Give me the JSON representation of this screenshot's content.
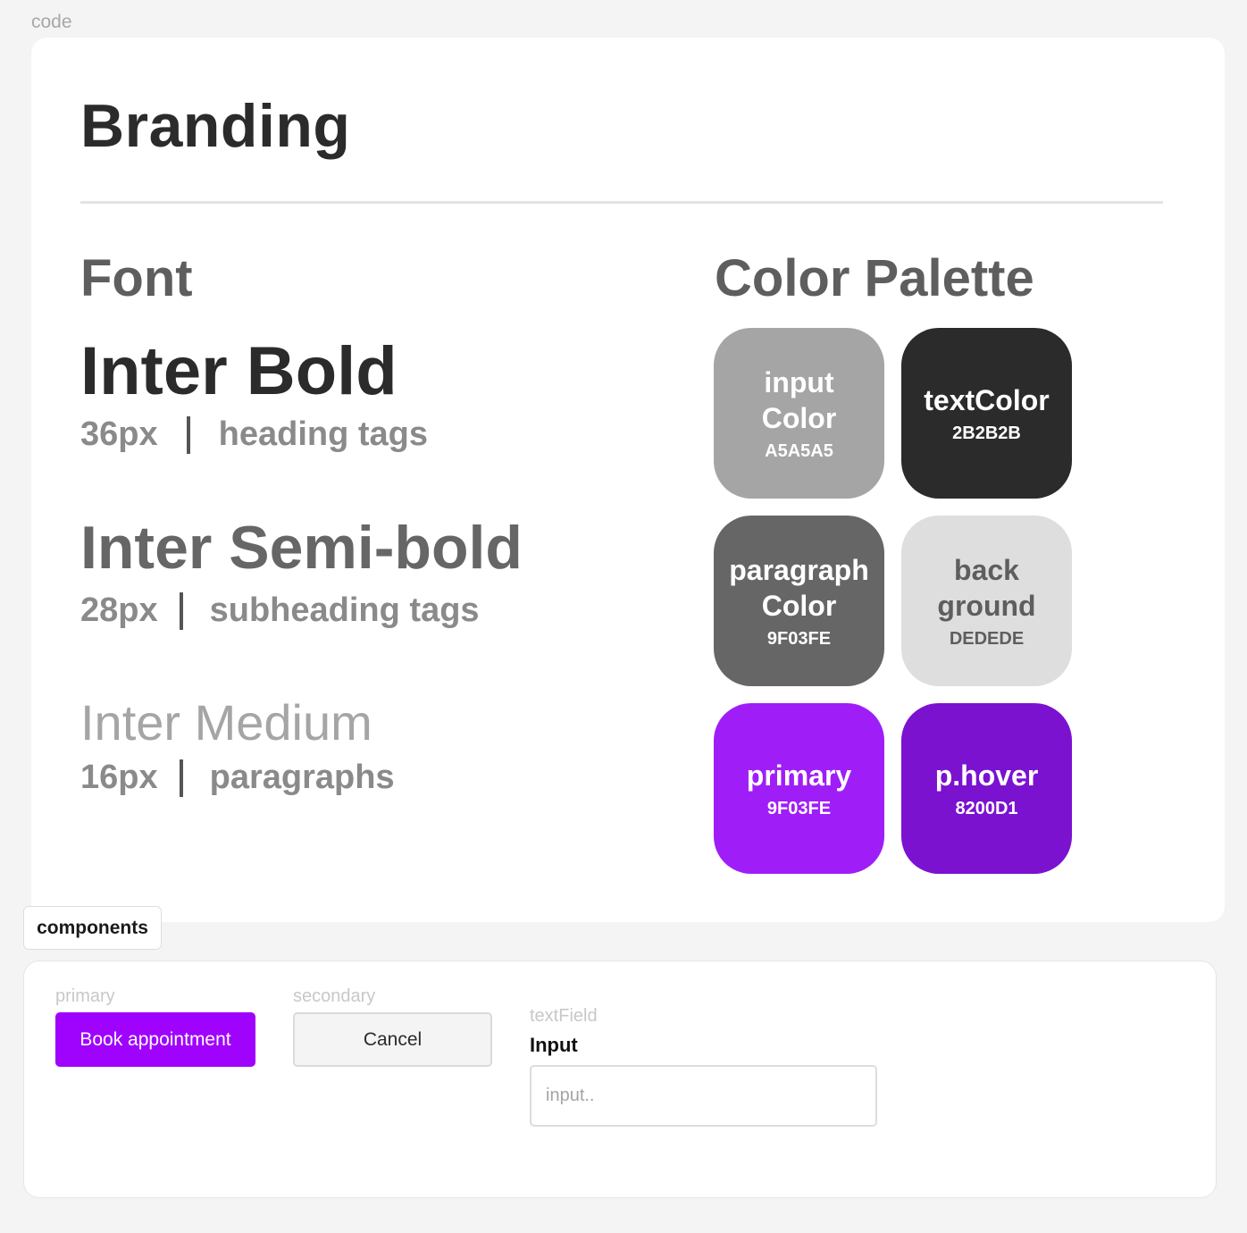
{
  "frame_label": "code",
  "branding": {
    "title": "Branding",
    "font": {
      "heading": "Font",
      "samples": [
        {
          "name": "Inter Bold",
          "size": "36px",
          "usage": "heading tags"
        },
        {
          "name": "Inter Semi-bold",
          "size": "28px",
          "usage": "subheading tags"
        },
        {
          "name": "Inter Medium",
          "size": "16px",
          "usage": "paragraphs"
        }
      ]
    },
    "palette": {
      "heading": "Color Palette",
      "swatches": [
        {
          "line1": "input",
          "line2": "Color",
          "hex": "A5A5A5",
          "bg": "#a5a5a5",
          "fg": "#ffffff"
        },
        {
          "line1": "textColor",
          "line2": "",
          "hex": "2B2B2B",
          "bg": "#2b2b2b",
          "fg": "#ffffff"
        },
        {
          "line1": "paragraph",
          "line2": "Color",
          "hex": "9F03FE",
          "bg": "#666666",
          "fg": "#ffffff"
        },
        {
          "line1": "back",
          "line2": "ground",
          "hex": "DEDEDE",
          "bg": "#dedede",
          "fg": "#5e5e5e"
        },
        {
          "line1": "primary",
          "line2": "",
          "hex": "9F03FE",
          "bg": "#9f1ef8",
          "fg": "#ffffff"
        },
        {
          "line1": "p.hover",
          "line2": "",
          "hex": "8200D1",
          "bg": "#7a12d0",
          "fg": "#ffffff"
        }
      ]
    }
  },
  "components": {
    "tab_label": "components",
    "primary": {
      "caption": "primary",
      "label": "Book appointment"
    },
    "secondary": {
      "caption": "secondary",
      "label": "Cancel"
    },
    "text_field": {
      "caption": "textField",
      "label": "Input",
      "placeholder": "input..",
      "value": ""
    }
  }
}
